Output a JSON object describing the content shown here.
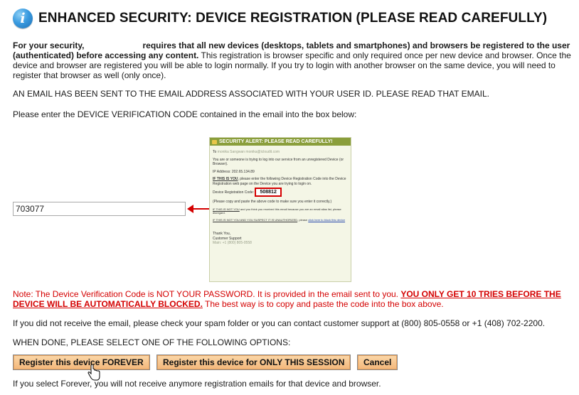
{
  "header": {
    "icon": "info-icon",
    "title": "ENHANCED SECURITY: DEVICE REGISTRATION (PLEASE READ CAREFULLY)"
  },
  "intro": {
    "bold_a": "For your security,",
    "bold_b": "requires that all new devices (desktops, tablets and smartphones) and browsers be registered to the user (authenticated) before accessing any content.",
    "normal": " This registration is browser specific and only required once per new device and browser. Once the device and browser are registered you will be able to login normally. If you try to login with another browser on the same device, you will need to register that browser as well (only once)."
  },
  "email_sent": "AN EMAIL HAS BEEN SENT TO THE EMAIL ADDRESS ASSOCIATED WITH YOUR USER ID. PLEASE READ THAT EMAIL.",
  "instruction": "Please enter the DEVICE VERIFICATION CODE contained in the email into the box below:",
  "code_input": {
    "value": "703077"
  },
  "email_preview": {
    "bar_title": "SECURITY ALERT: PLEASE READ CAREFULLY!",
    "to_label": "To",
    "to_value": "monika Sangwan monika@icloudit.com",
    "line1": "You are or someone is trying to log into our service from an unregistered Device (or Browser).",
    "ip": "IP Address: 202.65.134.89",
    "if_you_u": "IF THIS IS YOU",
    "if_you_rest": ", please enter the following Device Registration Code into the Device Registration web page on the Device you are trying to login on.",
    "code_label": "Device Registration Code:",
    "code_value": "508812",
    "copy_note": "(Please copy and paste the above code to make sure you enter it correctly.)",
    "not_you_u": "IF THIS IS NOT YOU",
    "not_you_rest": " and you think you received this email because you are an email alias list, please disregard.",
    "unauth_u": "IF THIS IS NOT YOU AND YOU SUSPECT IT IS UNAUTHORIZED",
    "unauth_rest": ", please ",
    "unauth_link": "click here to block this device",
    "thanks": "Thank You,",
    "support": "Customer Support",
    "main": "Main: +1 (800) 805-0558"
  },
  "note": {
    "normal": "Note: The Device Verification Code is NOT YOUR PASSWORD. It is provided in the email sent to you. ",
    "bold_u": "YOU ONLY GET 10 TRIES BEFORE THE DEVICE WILL BE AUTOMATICALLY BLOCKED.",
    "tail": " The best way is to copy and paste the code into the box above."
  },
  "support_text": "If you did not receive the email, please check your spam folder or you can contact customer support at (800) 805-0558 or +1 (408) 702-2200.",
  "when_done": "WHEN DONE, PLEASE SELECT ONE OF THE FOLLOWING OPTIONS:",
  "buttons": {
    "forever": "Register this device FOREVER",
    "session": "Register this device for ONLY THIS SESSION",
    "cancel": "Cancel"
  },
  "footer": "If you select Forever, you will not receive anymore registration emails for that device and browser.",
  "colors": {
    "alert_red": "#d40000",
    "button": "#f3b77a",
    "email_bar": "#8a9e3b"
  }
}
